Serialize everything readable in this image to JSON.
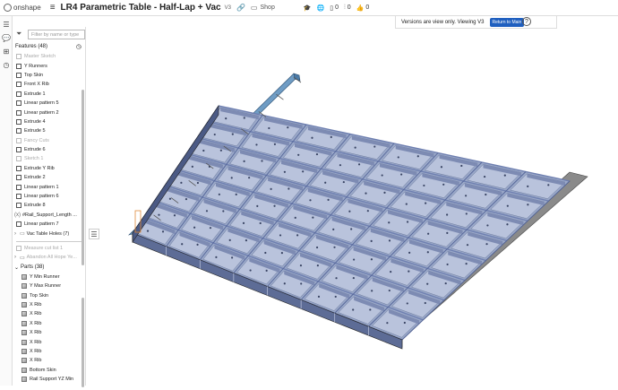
{
  "app": {
    "logo_text": "onshape"
  },
  "document": {
    "title": "LR4 Parametric Table - Half-Lap + Vac",
    "version_tag": "V3",
    "folder": "Shop"
  },
  "stats": {
    "a": "0",
    "b": "0",
    "c": "0"
  },
  "filter": {
    "placeholder": "Filter by name or type"
  },
  "features": {
    "header": "Features (48)",
    "items": [
      {
        "label": "Master Sketch",
        "dim": true,
        "kind": "sketch"
      },
      {
        "label": "Y Runners",
        "dim": false,
        "kind": "feature"
      },
      {
        "label": "Top Skin",
        "dim": false,
        "kind": "feature"
      },
      {
        "label": "Front X Rib",
        "dim": false,
        "kind": "feature"
      },
      {
        "label": "Extrude 1",
        "dim": false,
        "kind": "feature"
      },
      {
        "label": "Linear pattern 5",
        "dim": false,
        "kind": "feature"
      },
      {
        "label": "Linear pattern 2",
        "dim": false,
        "kind": "feature"
      },
      {
        "label": "Extrude 4",
        "dim": false,
        "kind": "feature"
      },
      {
        "label": "Extrude 5",
        "dim": false,
        "kind": "feature"
      },
      {
        "label": "Fancy Cuts",
        "dim": true,
        "kind": "sketch"
      },
      {
        "label": "Extrude 6",
        "dim": false,
        "kind": "feature"
      },
      {
        "label": "Sketch 1",
        "dim": true,
        "kind": "sketch"
      },
      {
        "label": "Extrude Y Rib",
        "dim": false,
        "kind": "feature"
      },
      {
        "label": "Extrude 2",
        "dim": false,
        "kind": "feature"
      },
      {
        "label": "Linear pattern 1",
        "dim": false,
        "kind": "feature"
      },
      {
        "label": "Linear pattern 6",
        "dim": false,
        "kind": "feature"
      },
      {
        "label": "Extrude 8",
        "dim": false,
        "kind": "feature"
      },
      {
        "label": "#Rail_Support_Length ...",
        "dim": false,
        "kind": "variable"
      },
      {
        "label": "Linear pattern 7",
        "dim": false,
        "kind": "feature"
      },
      {
        "label": "Vac Table Holes (7)",
        "dim": false,
        "kind": "folder"
      }
    ],
    "rollback": [
      {
        "label": "Measure cut list 1",
        "dim": true
      },
      {
        "label": "Abandon All Hope Ye...",
        "dim": true
      }
    ]
  },
  "parts": {
    "header": "Parts (38)",
    "items": [
      "Y Min Runner",
      "Y Max Runner",
      "Top Skin",
      "X Rib",
      "X Rib",
      "X Rib",
      "X Rib",
      "X Rib",
      "X Rib",
      "X Rib",
      "Bottom Skin",
      "Rail Support YZ Min"
    ]
  },
  "banner": {
    "text": "Versions are view only. Viewing V3",
    "button": "Return to Main"
  },
  "colors": {
    "accent": "#1f5fbf",
    "model_blue": "#9aa8c8",
    "rib_blue": "#6e7fb0",
    "rail_grey": "#8a8a8a",
    "rail_blue": "#6f9cc4",
    "orange": "#e08a3a"
  }
}
